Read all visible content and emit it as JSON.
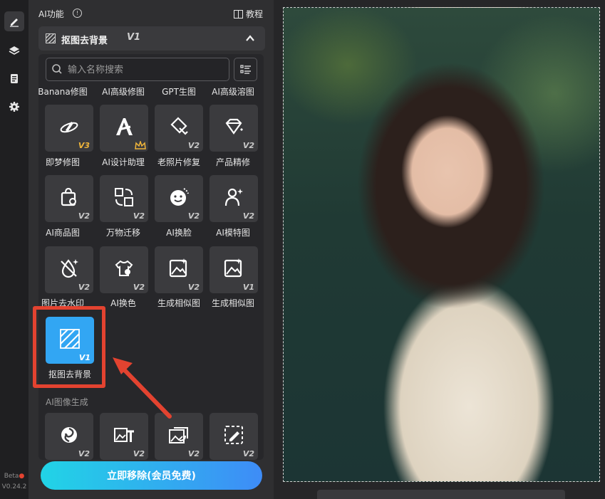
{
  "rail": {
    "items": [
      {
        "icon": "pen-icon",
        "active": true
      },
      {
        "icon": "layers-icon",
        "active": false
      },
      {
        "icon": "clipboard-icon",
        "active": false
      },
      {
        "icon": "gear-icon",
        "active": false
      }
    ],
    "beta": "Beta",
    "version": "V0.24.2"
  },
  "panel": {
    "title": "AI功能",
    "tutorial": "教程",
    "feature": {
      "label": "抠图去背景",
      "version": "V1"
    }
  },
  "search": {
    "placeholder": "输入名称搜索"
  },
  "top_labels": [
    "Banana修图",
    "AI高级修图",
    "GPT生图",
    "AI高级溶图"
  ],
  "tools": [
    {
      "label": "即梦修图",
      "version": "V3",
      "icon": "dream-edit-icon"
    },
    {
      "label": "AI设计助理",
      "version": "",
      "icon": "ai-design-icon",
      "crown": true
    },
    {
      "label": "老照片修复",
      "version": "V2",
      "icon": "photo-restore-icon"
    },
    {
      "label": "产品精修",
      "version": "V2",
      "icon": "product-retouch-icon"
    },
    {
      "label": "AI商品图",
      "version": "V2",
      "icon": "shopping-bag-icon"
    },
    {
      "label": "万物迁移",
      "version": "V2",
      "icon": "transfer-icon"
    },
    {
      "label": "AI换脸",
      "version": "V2",
      "icon": "face-swap-icon"
    },
    {
      "label": "AI模特图",
      "version": "V2",
      "icon": "model-icon"
    },
    {
      "label": "图片去水印",
      "version": "V2",
      "icon": "watermark-remove-icon"
    },
    {
      "label": "AI换色",
      "version": "V2",
      "icon": "color-change-icon"
    },
    {
      "label": "生成相似图",
      "version": "V2",
      "icon": "similar-image-icon"
    },
    {
      "label": "生成相似图",
      "version": "V1",
      "icon": "similar-image-icon"
    }
  ],
  "selected_tool": {
    "label": "抠图去背景",
    "version": "V1"
  },
  "section": {
    "title": "AI图像生成",
    "tiles": [
      {
        "version": "V2",
        "icon": "swirl-icon"
      },
      {
        "version": "V2",
        "icon": "image-text-icon"
      },
      {
        "version": "V2",
        "icon": "image-refresh-icon"
      },
      {
        "version": "V2",
        "icon": "image-edit-icon"
      }
    ]
  },
  "cta": {
    "label": "立即移除(会员免费)"
  },
  "colors": {
    "accent": "#32a6f3",
    "highlight": "#e34330",
    "gold": "#f0b53a"
  }
}
